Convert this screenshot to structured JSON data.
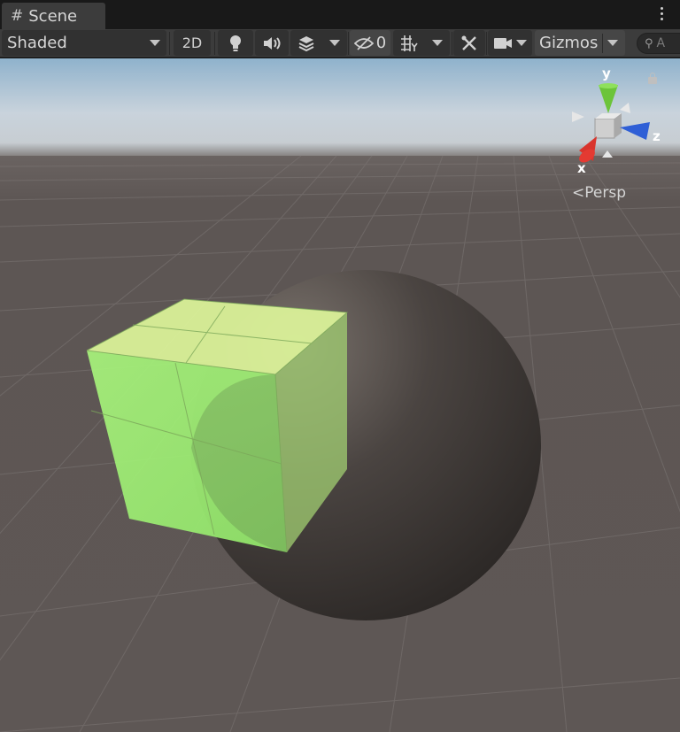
{
  "tab": {
    "icon": "hash-icon",
    "title": "Scene"
  },
  "toolbar": {
    "draw_mode": "Shaded",
    "two_d_label": "2D",
    "hidden_count": "0",
    "gizmos_label": "Gizmos",
    "search_placeholder": "A"
  },
  "gizmo": {
    "x_label": "x",
    "y_label": "y",
    "z_label": "z",
    "projection": "Persp"
  },
  "colors": {
    "sky": "#a9b3bf",
    "ground": "#5b5452",
    "cube_face_front": "#a6f27a",
    "cube_face_top": "#ddf59a",
    "sphere": "#3a3533",
    "axis_x": "#d9342c",
    "axis_y": "#6cc43a",
    "axis_z": "#2f5fd6"
  }
}
